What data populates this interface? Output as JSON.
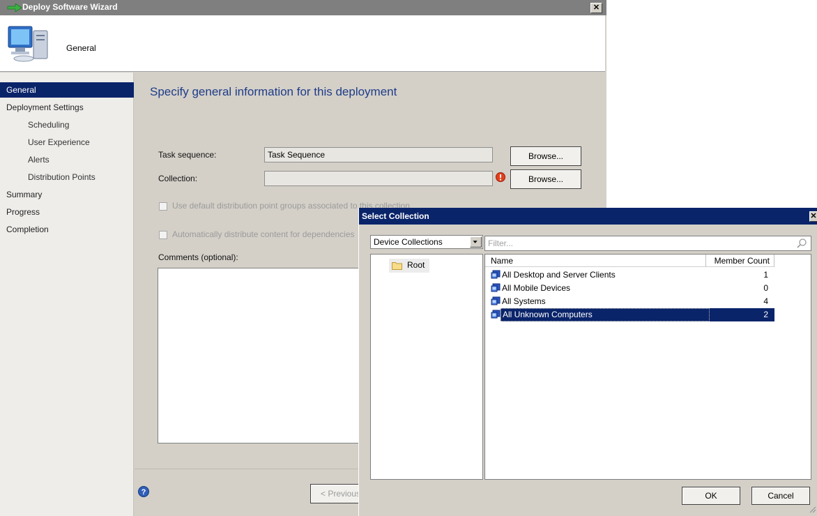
{
  "wizard": {
    "title": "Deploy Software Wizard",
    "header_title": "General",
    "nav": [
      {
        "label": "General",
        "active": true,
        "indent": false
      },
      {
        "label": "Deployment Settings",
        "active": false,
        "indent": false
      },
      {
        "label": "Scheduling",
        "active": false,
        "indent": true
      },
      {
        "label": "User Experience",
        "active": false,
        "indent": true
      },
      {
        "label": "Alerts",
        "active": false,
        "indent": true
      },
      {
        "label": "Distribution Points",
        "active": false,
        "indent": true
      },
      {
        "label": "Summary",
        "active": false,
        "indent": false
      },
      {
        "label": "Progress",
        "active": false,
        "indent": false
      },
      {
        "label": "Completion",
        "active": false,
        "indent": false
      }
    ],
    "heading": "Specify general information for this deployment",
    "task_sequence_label": "Task sequence:",
    "task_sequence_value": "Task Sequence",
    "collection_label": "Collection:",
    "collection_value": "",
    "browse_label": "Browse...",
    "checkbox_default_dp": "Use default distribution point groups associated to this collection",
    "checkbox_auto_distribute": "Automatically distribute content for dependencies",
    "comments_label": "Comments (optional):",
    "comments_value": "",
    "previous_label": "< Previous"
  },
  "dialog": {
    "title": "Select Collection",
    "collection_type": "Device Collections",
    "tree_root": "Root",
    "filter_placeholder": "Filter...",
    "columns": {
      "name": "Name",
      "member_count": "Member Count"
    },
    "rows": [
      {
        "name": "All Desktop and Server Clients",
        "count": "1",
        "selected": false
      },
      {
        "name": "All Mobile Devices",
        "count": "0",
        "selected": false
      },
      {
        "name": "All Systems",
        "count": "4",
        "selected": false
      },
      {
        "name": "All Unknown Computers",
        "count": "2",
        "selected": true
      }
    ],
    "ok_label": "OK",
    "cancel_label": "Cancel"
  }
}
